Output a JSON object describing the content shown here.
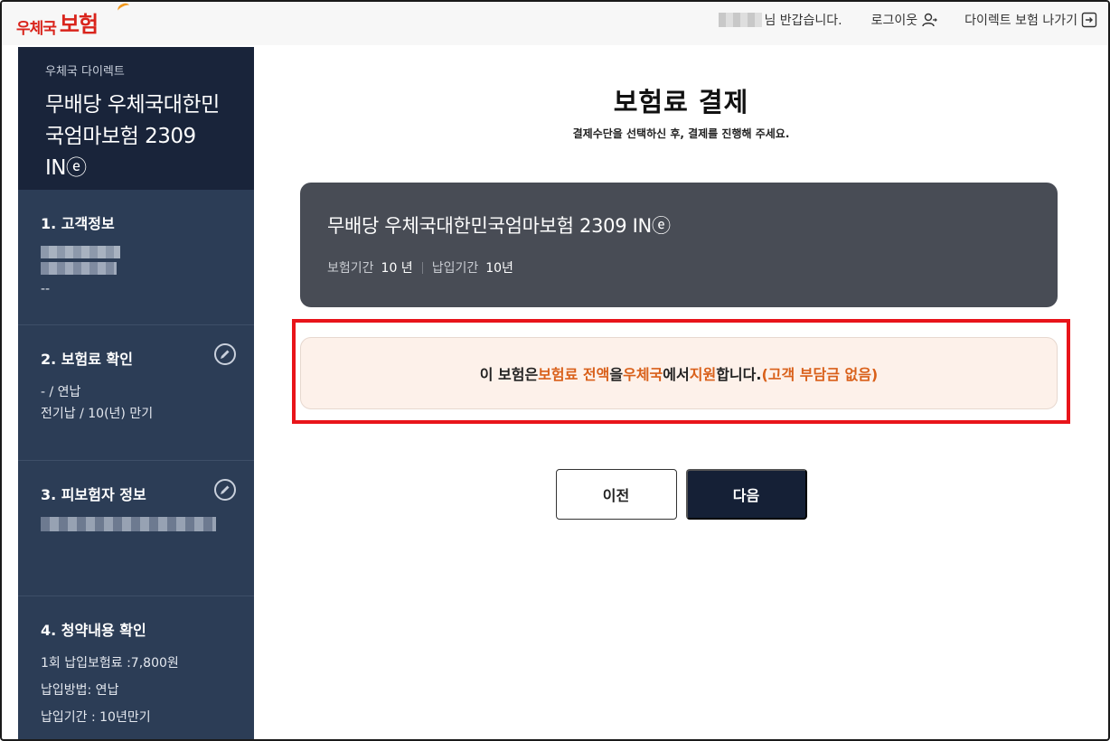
{
  "header": {
    "logo_small": "우체국",
    "logo_big": "보험",
    "greeting": "님 반갑습니다.",
    "logout": "로그이웃",
    "exit": "다이렉트 보험 나가기"
  },
  "sidebar": {
    "brand": "우체국 다이렉트",
    "product_title": "무배당 우체국대한민국엄마보험 2309 INⓔ",
    "sections": [
      {
        "title": "1. 고객정보",
        "lines": [
          "--"
        ]
      },
      {
        "title": "2. 보험료 확인",
        "lines": [
          "- / 연납",
          "전기납 / 10(년) 만기"
        ]
      },
      {
        "title": "3. 피보험자 정보",
        "lines": []
      },
      {
        "title": "4. 청약내용 확인",
        "lines": [
          "1회 납입보험료 :7,800원",
          "납입방법: 연납",
          "납입기간 : 10년만기"
        ]
      }
    ]
  },
  "main": {
    "title": "보험료 결제",
    "subtitle": "결제수단을 선택하신 후, 결제를 진행해 주세요.",
    "product": {
      "name": "무배당 우체국대한민국엄마보험 2309 INⓔ",
      "period_label": "보험기간",
      "period_value": "10 년",
      "pay_label": "납입기간",
      "pay_value": "10년"
    },
    "notice": {
      "p1": "이 보험은 ",
      "e1": "보험료 전액",
      "p2": "을 ",
      "e2": "우체국",
      "p3": "에서 ",
      "e3": "지원",
      "p4": "합니다.",
      "e4": "(고객 부담금 없음)"
    },
    "buttons": {
      "prev": "이전",
      "next": "다음"
    }
  },
  "colors": {
    "accent_red": "#d9241c",
    "highlight_orange": "#d9601a",
    "sidebar": "#2c3d56",
    "navy": "#152036"
  }
}
